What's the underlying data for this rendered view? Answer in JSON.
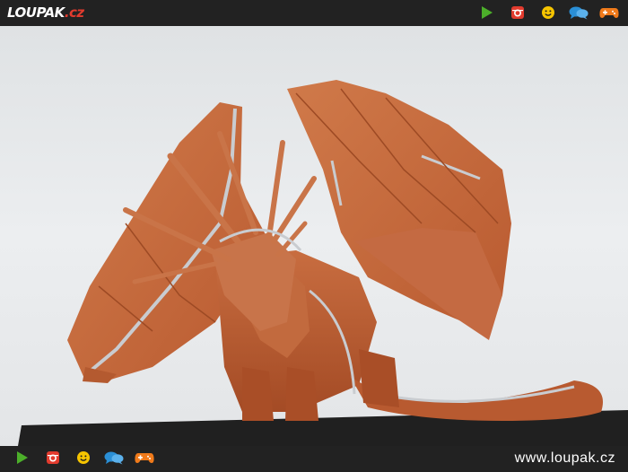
{
  "brand": {
    "logo_main": "LOUPAK",
    "logo_tld": ".cz"
  },
  "top_icons": [
    "play-icon",
    "instagram-icon",
    "smiley-icon",
    "chat-icon",
    "gamepad-icon"
  ],
  "bottom_icons": [
    "play-icon",
    "instagram-icon",
    "smiley-icon",
    "chat-icon",
    "gamepad-icon"
  ],
  "footer": {
    "url": "www.loupak.cz"
  },
  "photo": {
    "subject": "origami-dragon"
  },
  "colors": {
    "bar": "#222222",
    "play": "#4caf2a",
    "instagram": "#e23b2e",
    "smiley": "#f5c400",
    "chat": "#2a8fd6",
    "gamepad": "#f07a1a",
    "paper": "#c96a3e",
    "foil": "#c9ccd0"
  }
}
